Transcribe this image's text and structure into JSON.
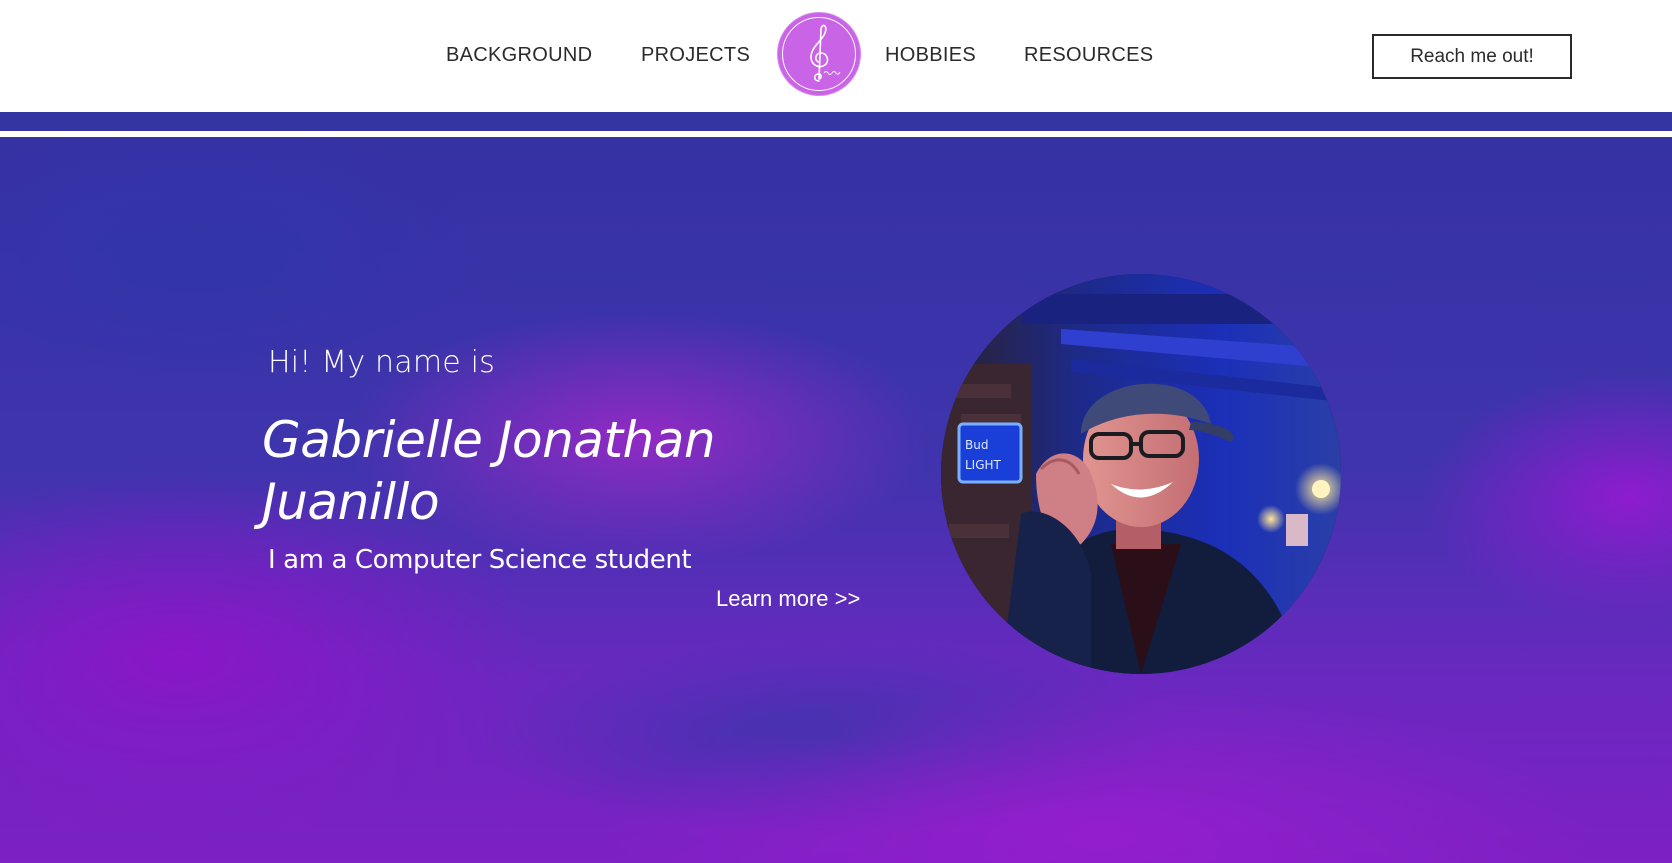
{
  "header": {
    "nav": [
      {
        "label": "BACKGROUND"
      },
      {
        "label": "PROJECTS"
      },
      {
        "label": "HOBBIES"
      },
      {
        "label": "RESOURCES"
      }
    ],
    "logo": {
      "icon": "treble-clef-icon",
      "signature": "Juanillo"
    },
    "cta_label": "Reach me out!"
  },
  "hero": {
    "greeting": "Hi! My name is",
    "name_line1": "Gabrielle Jonathan",
    "name_line2": "Juanillo",
    "role": "I am a Computer Science student",
    "learn_more": "Learn more >>",
    "portrait": {
      "icon": "profile-photo"
    }
  },
  "colors": {
    "accent": "#c964e6",
    "band": "#3434a3",
    "hero_blue": "#3532a4",
    "hero_purple": "#8a18c8"
  }
}
